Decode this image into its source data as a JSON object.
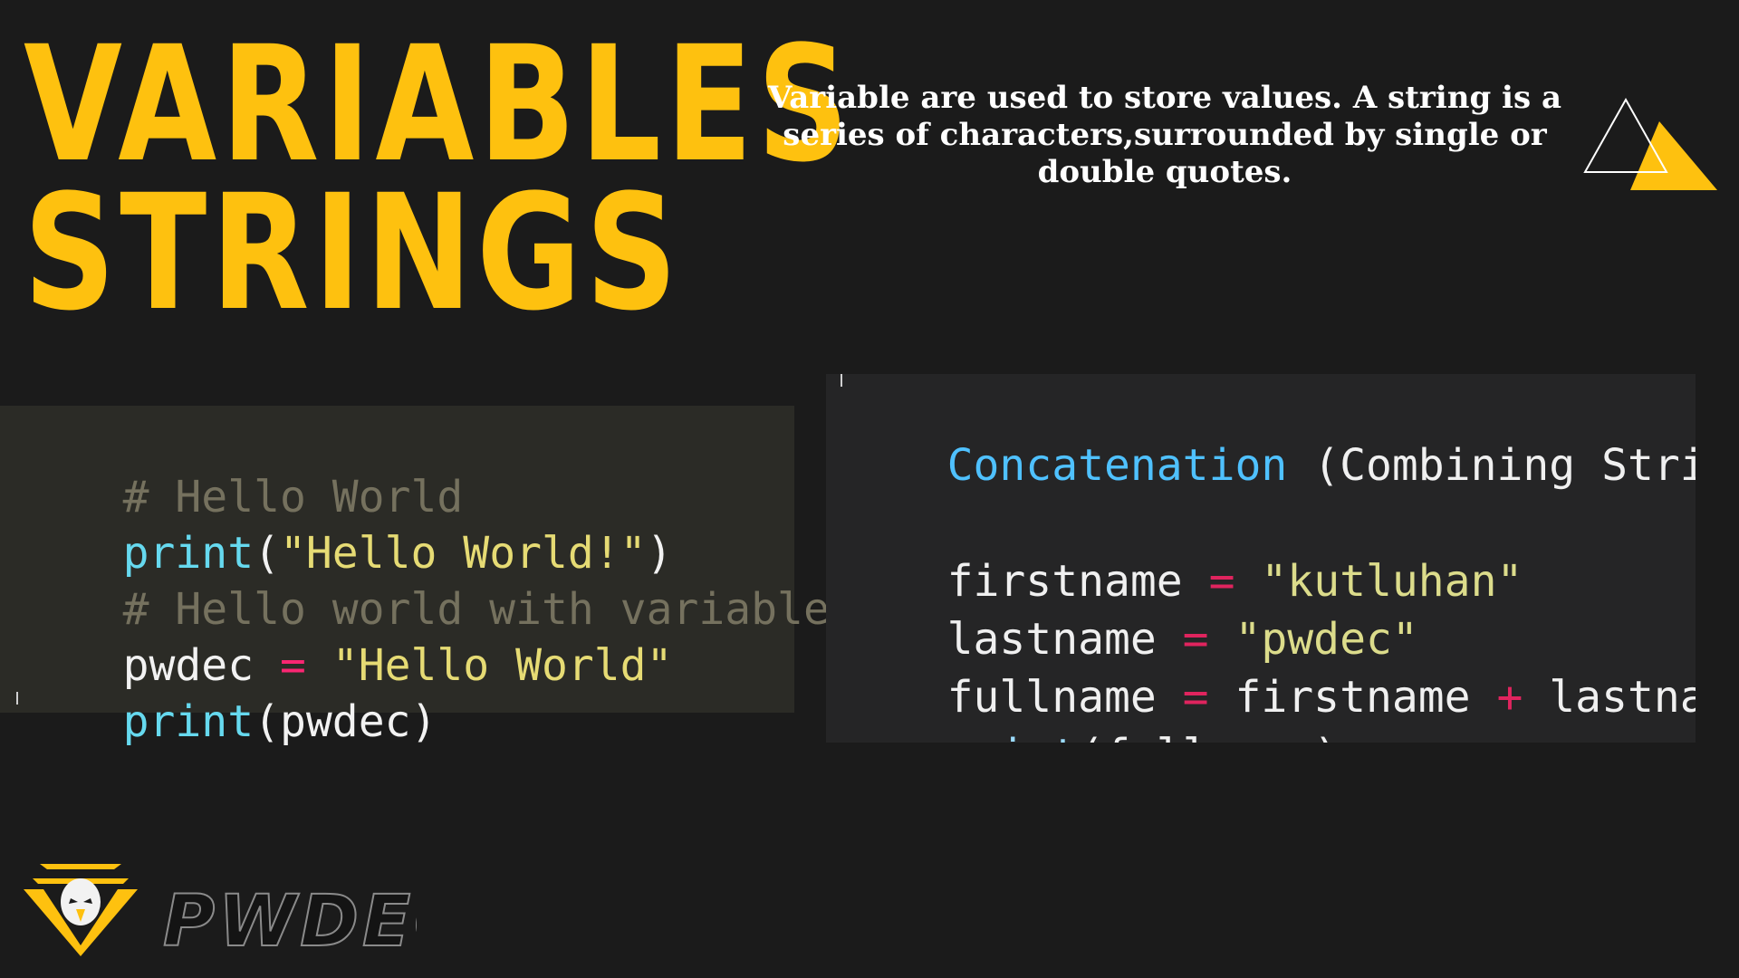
{
  "heading": {
    "line1": "VARIABLES",
    "line2": "STRINGS"
  },
  "description": "Variable are used to store values. A string is a series of characters,surrounded by single or double quotes.",
  "colors": {
    "accent": "#fec10f",
    "background": "#1b1b1b"
  },
  "left_code": {
    "line1_comment": "# Hello World",
    "line2_func": "print",
    "line2_open": "(",
    "line2_string": "\"Hello World!\"",
    "line2_close": ")",
    "line3_comment": "# Hello world with variable",
    "line4_var": "pwdec",
    "line4_op": " = ",
    "line4_string": "\"Hello World\"",
    "line5_func": "print",
    "line5_args": "(pwdec)"
  },
  "right_code": {
    "heading_keyword": "Concatenation",
    "heading_rest": " (Combining Strings)",
    "line1_var": "firstname",
    "line1_op": " = ",
    "line1_string": "\"kutluhan\"",
    "line2_var": "lastname",
    "line2_op": " = ",
    "line2_string": "\"pwdec\"",
    "line3_var": "fullname",
    "line3_op": " = ",
    "line3_a": "firstname",
    "line3_plus": " + ",
    "line3_b": "lastname",
    "line4_func": "print",
    "line4_args": "(fullname)"
  },
  "logo": {
    "wordmark": "PWDEC",
    "emblem_icon": "eagle-shield-icon"
  }
}
